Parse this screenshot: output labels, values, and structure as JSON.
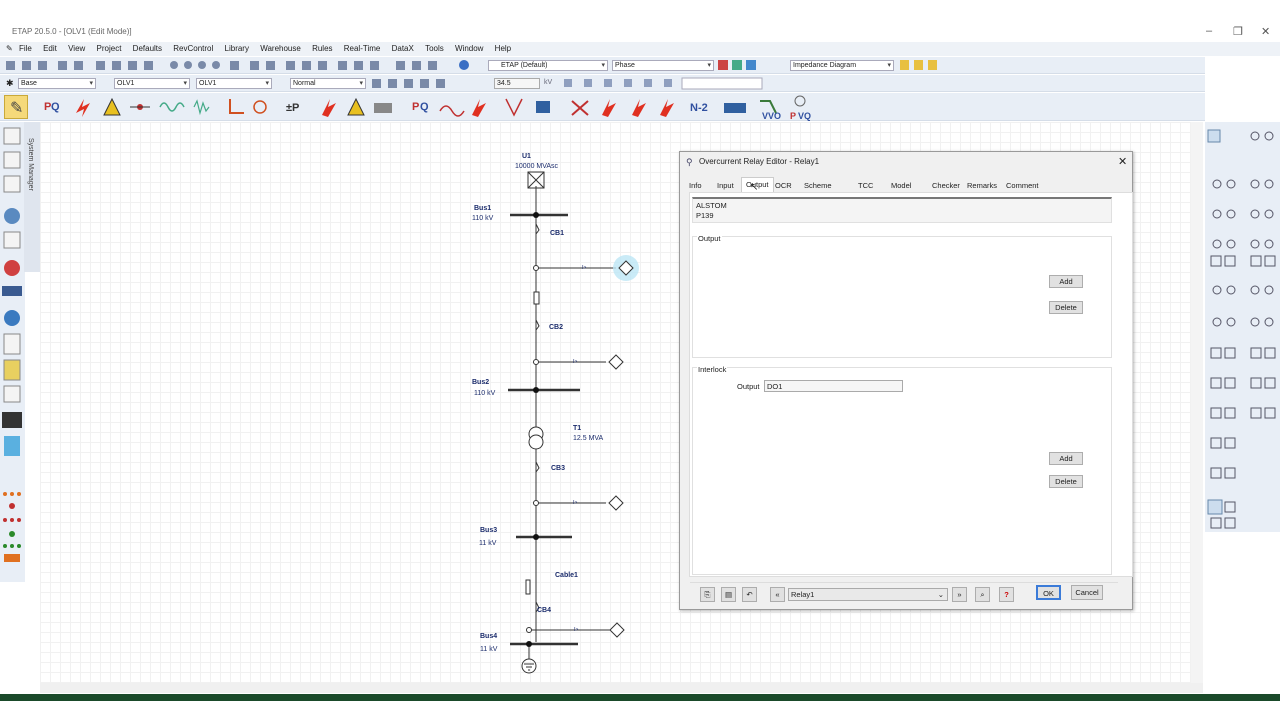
{
  "window": {
    "title": "ETAP 20.5.0 - [OLV1 (Edit Mode)]"
  },
  "menu": [
    "File",
    "Edit",
    "View",
    "Project",
    "Defaults",
    "RevControl",
    "Library",
    "Warehouse",
    "Rules",
    "Real-Time",
    "DataX",
    "Tools",
    "Window",
    "Help"
  ],
  "toolbar": {
    "etap_mode": "ETAP (Default)",
    "phase": "Phase",
    "view": "Impedance Diagram",
    "base": "Base",
    "olv_a": "OLV1",
    "olv_b": "OLV1",
    "style": "Normal",
    "zoom": "34.5",
    "kv": "kV"
  },
  "sidebar": {
    "system_manager": "System Manager"
  },
  "oneline": {
    "u1": {
      "name": "U1",
      "rating": "10000 MVAsc"
    },
    "bus1": {
      "name": "Bus1",
      "kv": "110 kV"
    },
    "cb1": "CB1",
    "cb2": "CB2",
    "bus2": {
      "name": "Bus2",
      "kv": "110 kV"
    },
    "t1": {
      "name": "T1",
      "rating": "12.5 MVA"
    },
    "cb3": "CB3",
    "bus3": {
      "name": "Bus3",
      "kv": "11 kV"
    },
    "cable1": "Cable1",
    "cb4": "CB4",
    "bus4": {
      "name": "Bus4",
      "kv": "11 kV"
    },
    "relay_symbol": "I>"
  },
  "dialog": {
    "title": "Overcurrent Relay Editor - Relay1",
    "tabs": [
      "Info",
      "Input",
      "Output",
      "OCR",
      "Scheme Logic",
      "TCC kA",
      "Model Info",
      "Checker",
      "Remarks",
      "Comment"
    ],
    "active_tab": "Output",
    "manufacturer": "ALSTOM",
    "model": "P139",
    "output_group": "Output",
    "interlock_group": "Interlock",
    "interlock_output_label": "Output",
    "interlock_output_value": "DO1",
    "add": "Add",
    "delete": "Delete",
    "relay_select": "Relay1",
    "ok": "OK",
    "cancel": "Cancel"
  }
}
